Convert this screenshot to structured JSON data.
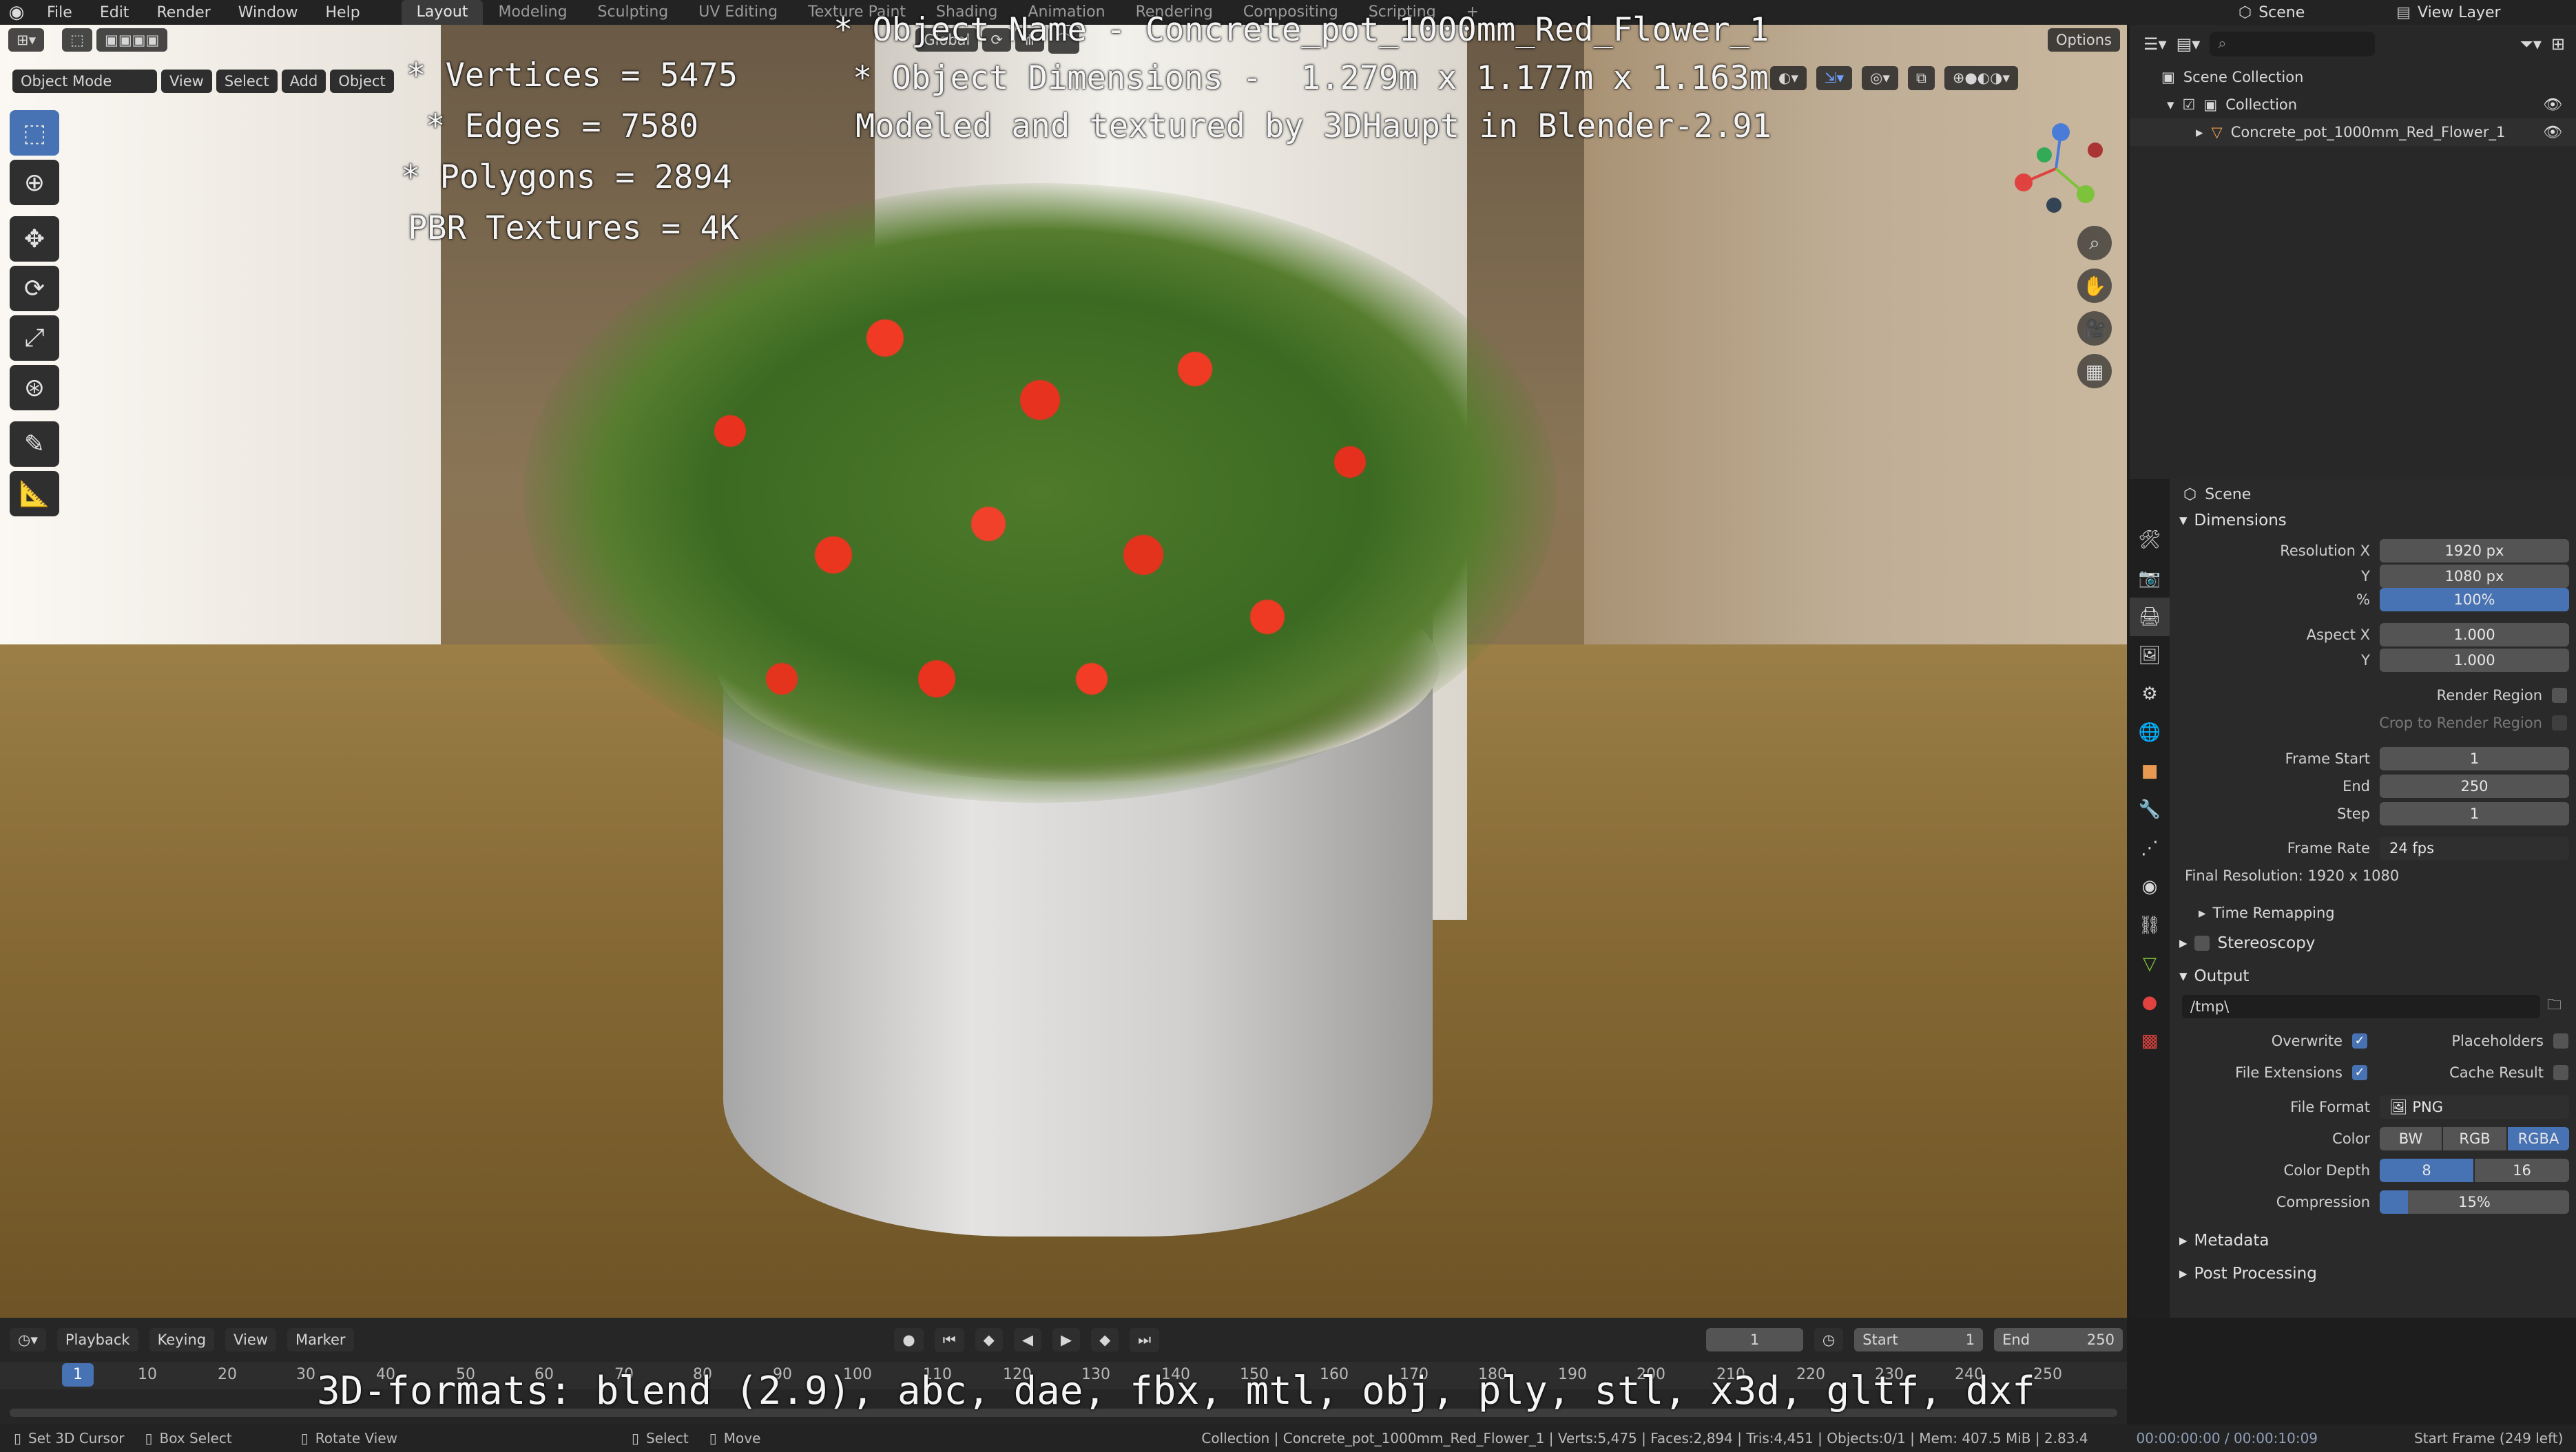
{
  "menu": [
    "File",
    "Edit",
    "Render",
    "Window",
    "Help"
  ],
  "workspaces": [
    "Layout",
    "Modeling",
    "Sculpting",
    "UV Editing",
    "Texture Paint",
    "Shading",
    "Animation",
    "Rendering",
    "Compositing",
    "Scripting"
  ],
  "active_workspace": "Layout",
  "scene_label": "Scene",
  "view_layer_label": "View Layer",
  "viewport": {
    "mode": "Object Mode",
    "menus": [
      "View",
      "Select",
      "Add",
      "Object"
    ],
    "orientation": "Global",
    "options": "Options",
    "overlay_text": {
      "left": [
        "* Vertices = 5475",
        "* Edges = 7580",
        "* Polygons = 2894",
        "PBR Textures = 4K"
      ],
      "top": [
        "* Object Name - Concrete_pot_1000mm_Red_Flower_1",
        "* Object Dimensions -  1.279m x 1.177m x 1.163m",
        "Modeled and textured by 3DHaupt in Blender-2.91"
      ],
      "bottom": "3D-formats: blend (2.9), abc, dae, fbx, mtl, obj, ply, stl, x3d, gltf, dxf"
    }
  },
  "outliner": {
    "items": [
      "Scene Collection",
      "Collection",
      "Concrete_pot_1000mm_Red_Flower_1"
    ]
  },
  "properties": {
    "context": "Scene",
    "dimensions_title": "Dimensions",
    "resolution_x_label": "Resolution X",
    "resolution_x": "1920 px",
    "y_label": "Y",
    "resolution_y": "1080 px",
    "pct_label": "%",
    "resolution_pct": "100%",
    "aspect_x_label": "Aspect X",
    "aspect_x": "1.000",
    "aspect_y": "1.000",
    "render_region": "Render Region",
    "crop_region": "Crop to Render Region",
    "frame_start_label": "Frame Start",
    "frame_start": "1",
    "end_label": "End",
    "frame_end": "250",
    "step_label": "Step",
    "frame_step": "1",
    "frame_rate_label": "Frame Rate",
    "frame_rate": "24 fps",
    "final_resolution": "Final Resolution: 1920 x 1080",
    "time_remapping": "Time Remapping",
    "stereoscopy": "Stereoscopy",
    "output_title": "Output",
    "output_path": "/tmp\\",
    "overwrite": "Overwrite",
    "placeholders": "Placeholders",
    "file_extensions": "File Extensions",
    "cache_result": "Cache Result",
    "file_format_label": "File Format",
    "file_format": "PNG",
    "color_label": "Color",
    "color_options": [
      "BW",
      "RGB",
      "RGBA"
    ],
    "color_depth_label": "Color Depth",
    "color_depth_options": [
      "8",
      "16"
    ],
    "compression_label": "Compression",
    "compression": "15%",
    "metadata": "Metadata",
    "post_processing": "Post Processing"
  },
  "timeline": {
    "menus": [
      "Playback",
      "Keying",
      "View",
      "Marker"
    ],
    "current_frame": "1",
    "start_label": "Start",
    "start": "1",
    "end_label": "End",
    "end": "250",
    "ticks": [
      "1",
      "10",
      "20",
      "30",
      "40",
      "50",
      "60",
      "70",
      "80",
      "90",
      "100",
      "110",
      "120",
      "130",
      "140",
      "150",
      "160",
      "170",
      "180",
      "190",
      "200",
      "210",
      "220",
      "230",
      "240",
      "250"
    ]
  },
  "status": {
    "set_cursor": "Set 3D Cursor",
    "box_select": "Box Select",
    "rotate_view": "Rotate View",
    "select": "Select",
    "move": "Move",
    "info": "Collection | Concrete_pot_1000mm_Red_Flower_1 | Verts:5,475 | Faces:2,894 | Tris:4,451 | Objects:0/1 | Mem: 407.5 MiB | 2.83.4",
    "time": "00:00:00:00 / 00:00:10:09",
    "start_frame": "Start Frame (249 left)"
  },
  "colors": {
    "accent": "#4772b3",
    "header": "#232323",
    "panel": "#2a2a2a"
  }
}
